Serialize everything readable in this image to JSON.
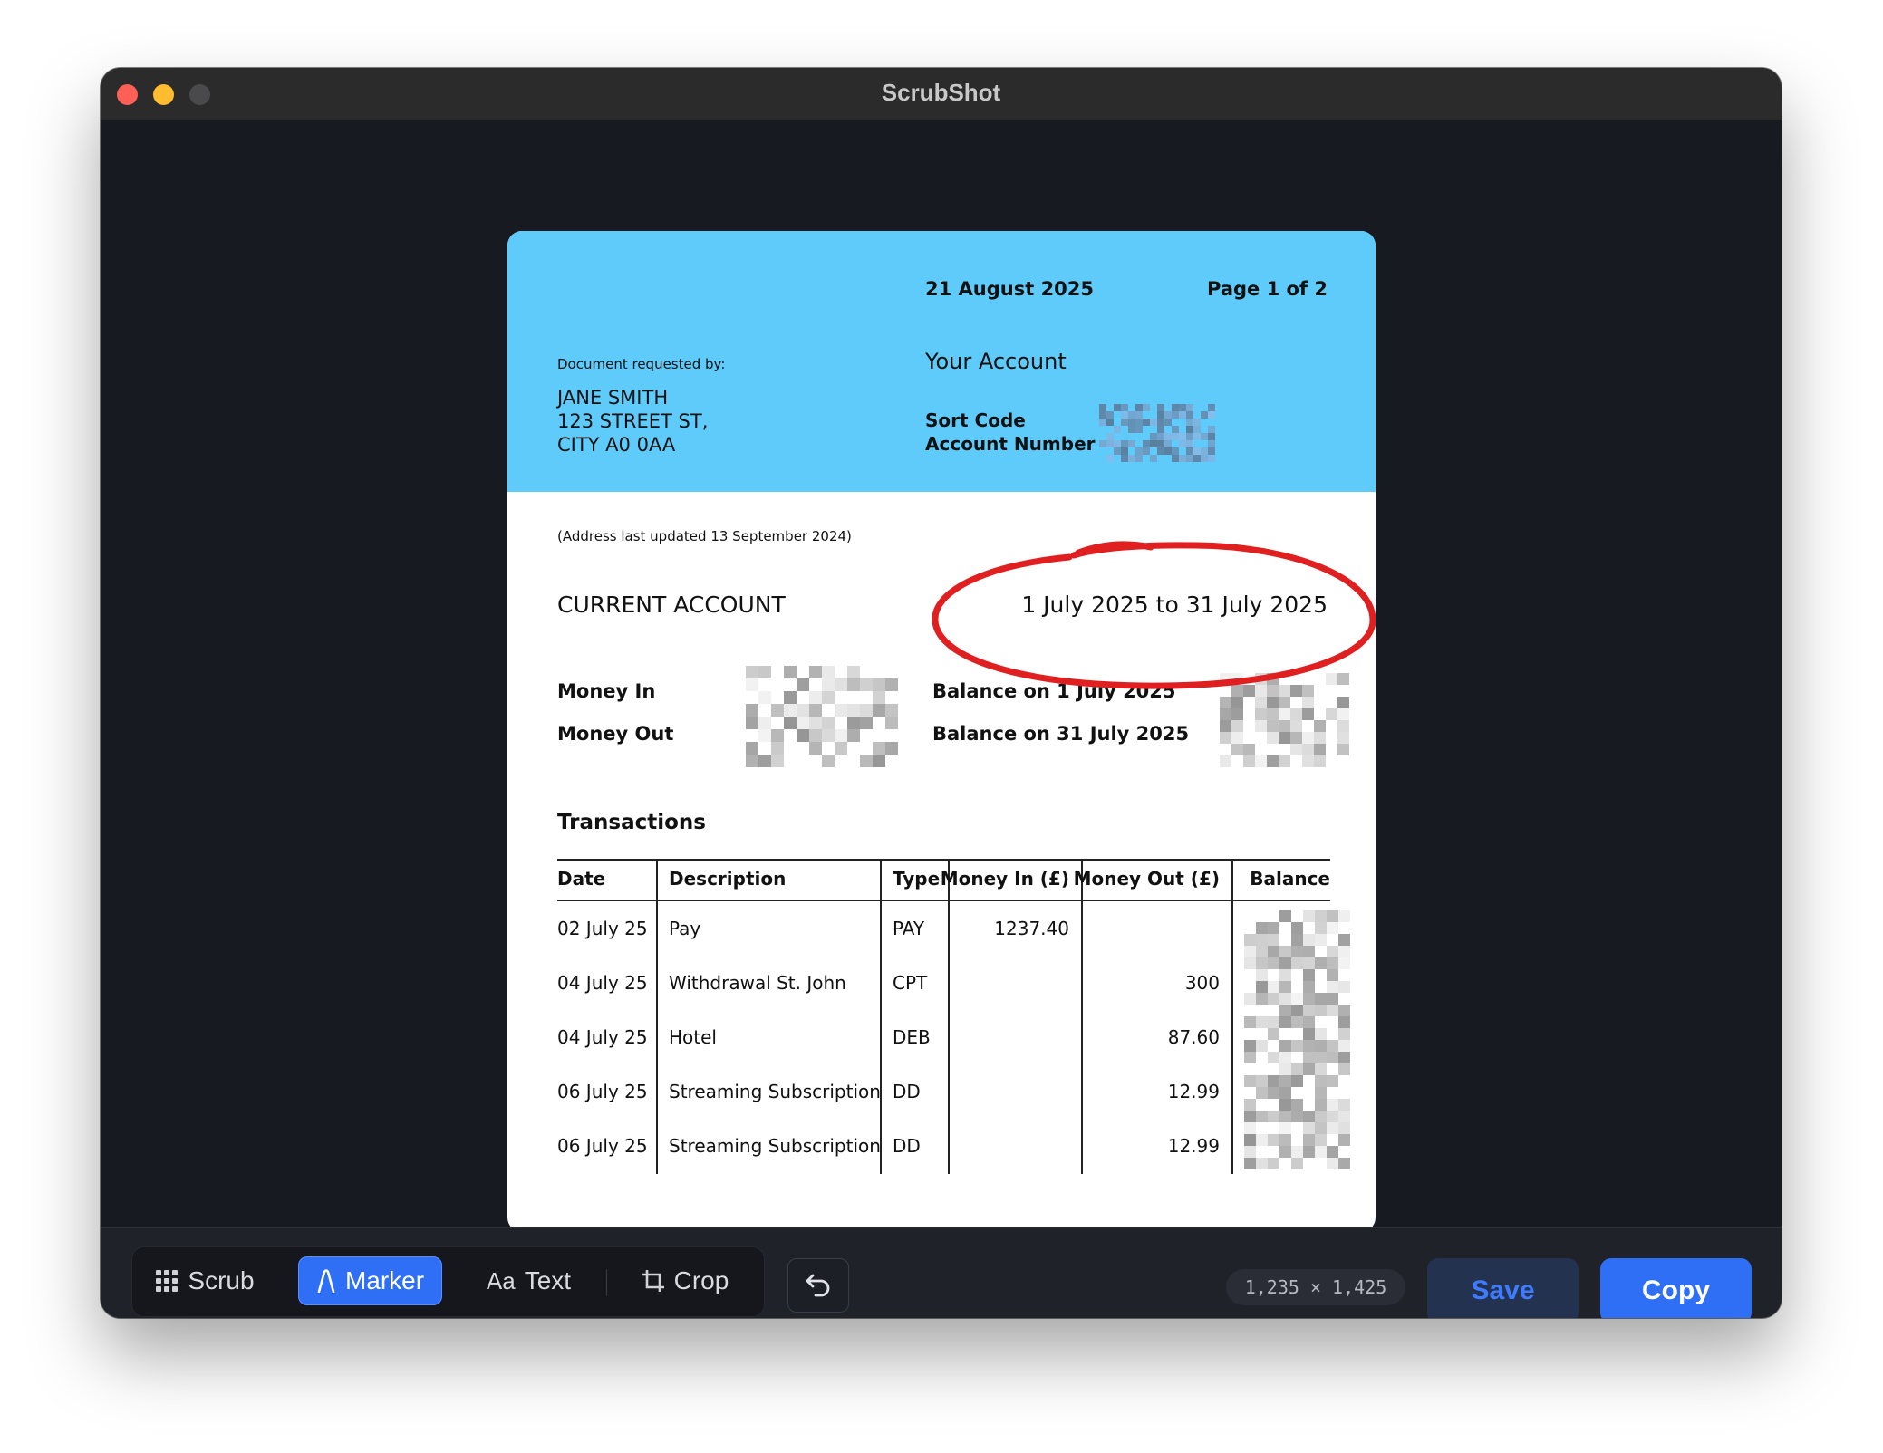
{
  "window": {
    "title": "ScrubShot"
  },
  "doc": {
    "date": "21 August 2025",
    "page": "Page 1 of 2",
    "requested_by_label": "Document requested by:",
    "name": "JANE SMITH",
    "address_line1": "123 STREET ST,",
    "address_line2": "CITY A0 0AA",
    "your_account": "Your Account",
    "sort_code_label": "Sort Code",
    "account_number_label": "Account Number",
    "address_updated": "(Address last updated 13 September 2024)",
    "account_type": "CURRENT ACCOUNT",
    "period": "1 July 2025 to 31 July 2025",
    "money_in_label": "Money In",
    "money_out_label": "Money Out",
    "balance_start_label": "Balance on 1 July 2025",
    "balance_end_label": "Balance on 31 July 2025",
    "transactions_title": "Transactions",
    "columns": [
      "Date",
      "Description",
      "Type",
      "Money In (£)",
      "Money Out (£)",
      "Balance"
    ],
    "rows": [
      [
        "02 July 25",
        "Pay",
        "PAY",
        "1237.40",
        "",
        ""
      ],
      [
        "04 July 25",
        "Withdrawal St. John",
        "CPT",
        "",
        "300",
        ""
      ],
      [
        "04 July 25",
        "Hotel",
        "DEB",
        "",
        "87.60",
        ""
      ],
      [
        "06 July 25",
        "Streaming Subscription",
        "DD",
        "",
        "12.99",
        ""
      ],
      [
        "06 July 25",
        "Streaming Subscription",
        "DD",
        "",
        "12.99",
        ""
      ]
    ],
    "marker_color": "#e02020"
  },
  "toolbar": {
    "tools": [
      {
        "label": "Scrub",
        "icon": "grid-icon",
        "active": false
      },
      {
        "label": "Marker",
        "icon": "marker-icon",
        "active": true
      },
      {
        "label": "Text",
        "icon": "text-icon",
        "icon_text": "Aa",
        "active": false
      },
      {
        "label": "Crop",
        "icon": "crop-icon",
        "active": false
      }
    ],
    "undo_icon": "undo-icon",
    "dimensions": "1,235 × 1,425",
    "save_label": "Save",
    "copy_label": "Copy"
  },
  "colors": {
    "accent": "#2f6ff5",
    "header_blue": "#5fcbfb"
  }
}
